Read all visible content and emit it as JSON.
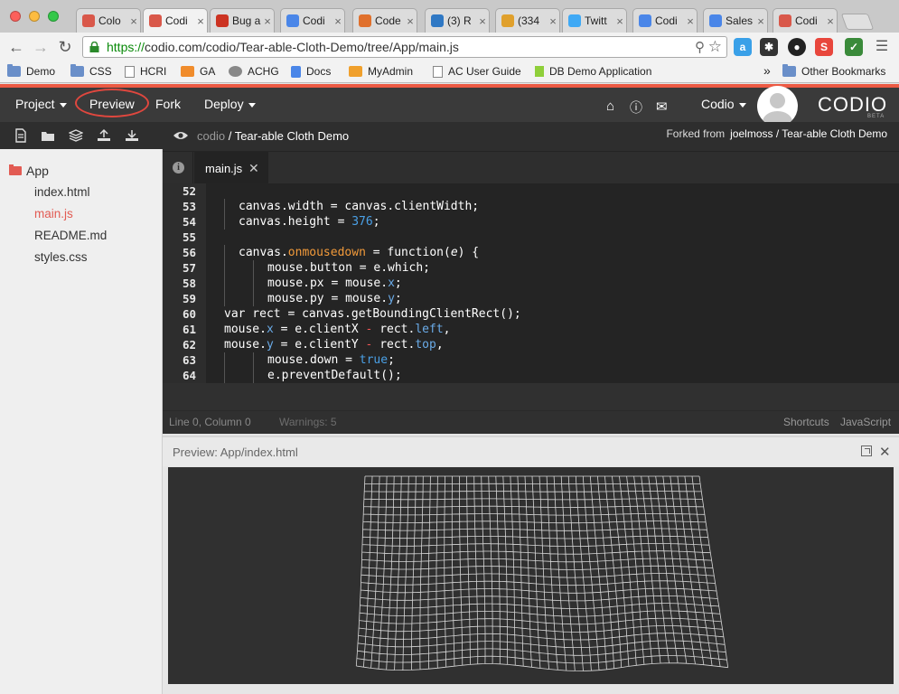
{
  "browser": {
    "tabs": [
      {
        "title": "Colo",
        "color": "#d9584a"
      },
      {
        "title": "Codi",
        "color": "#d9584a",
        "active": true
      },
      {
        "title": "Bug a",
        "color": "#cc3322"
      },
      {
        "title": "Codi",
        "color": "#4a86e8"
      },
      {
        "title": "Code",
        "color": "#e0702c"
      },
      {
        "title": "(3) R",
        "color": "#2f78c4"
      },
      {
        "title": "(334",
        "color": "#e0a02c"
      },
      {
        "title": "Twitt",
        "color": "#3fa9f5"
      },
      {
        "title": "Codi",
        "color": "#4a86e8"
      },
      {
        "title": "Sales",
        "color": "#4a86e8"
      },
      {
        "title": "Codi",
        "color": "#d9584a"
      }
    ],
    "url_protocol": "https://",
    "url_rest": "codio.com/codio/Tear-able-Cloth-Demo/tree/App/main.js",
    "bookmarks": [
      "Demo",
      "CSS",
      "HCRI",
      "GA",
      "ACHG",
      "Docs",
      "MyAdmin",
      "AC User Guide",
      "DB Demo Application"
    ],
    "bookmarks_overflow": "»",
    "other_bookmarks": "Other Bookmarks"
  },
  "codio": {
    "menu": {
      "project": "Project",
      "preview": "Preview",
      "fork": "Fork",
      "deploy": "Deploy"
    },
    "user": "Codio",
    "logo": "CODIO",
    "beta": "BETA",
    "breadcrumb_owner": "codio",
    "breadcrumb_sep": " / ",
    "breadcrumb_project": "Tear-able Cloth Demo",
    "forked_from_label": "Forked from",
    "forked_from_link": "joelmoss / Tear-able Cloth Demo",
    "tree": {
      "folder": "App",
      "files": [
        "index.html",
        "main.js",
        "README.md",
        "styles.css"
      ]
    },
    "open_tab": "main.js",
    "code_lines": [
      {
        "n": "52",
        "text": ""
      },
      {
        "n": "53",
        "text": "canvas.width = canvas.clientWidth;"
      },
      {
        "n": "54",
        "text": "canvas.height = 376;"
      },
      {
        "n": "55",
        "text": ""
      },
      {
        "n": "56",
        "text": "canvas.onmousedown = function(e) {"
      },
      {
        "n": "57",
        "text": "mouse.button = e.which;"
      },
      {
        "n": "58",
        "text": "mouse.px = mouse.x;"
      },
      {
        "n": "59",
        "text": "mouse.py = mouse.y;"
      },
      {
        "n": "60",
        "text": "var rect = canvas.getBoundingClientRect();"
      },
      {
        "n": "61",
        "text": "mouse.x = e.clientX - rect.left,"
      },
      {
        "n": "62",
        "text": "mouse.y = e.clientY - rect.top,"
      },
      {
        "n": "63",
        "text": "mouse.down = true;"
      },
      {
        "n": "64",
        "text": "e.preventDefault();"
      }
    ],
    "status": {
      "position": "Line 0, Column 0",
      "warnings": "Warnings: 5",
      "shortcuts": "Shortcuts",
      "language": "JavaScript"
    },
    "preview_title": "Preview: App/index.html"
  }
}
